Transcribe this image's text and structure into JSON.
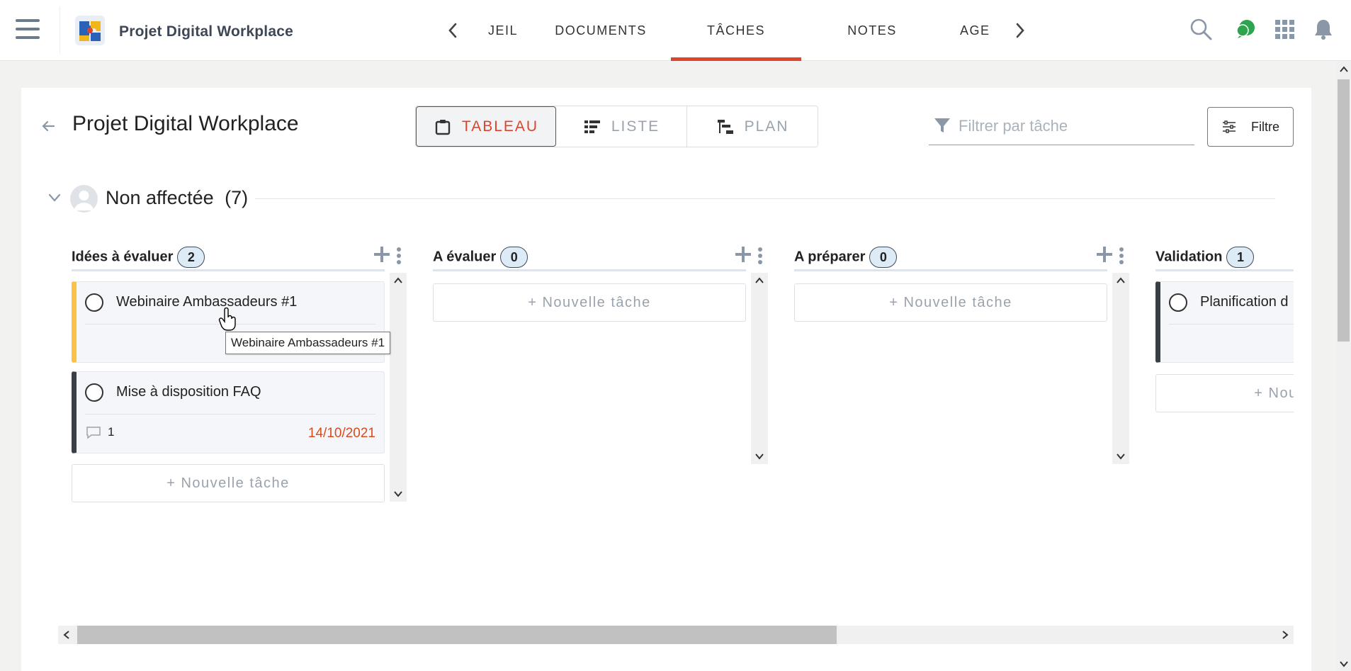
{
  "header": {
    "app_title": "Projet Digital Workplace",
    "tabs": [
      {
        "label": "JEIL"
      },
      {
        "label": "DOCUMENTS"
      },
      {
        "label": "TÂCHES",
        "active": true
      },
      {
        "label": "NOTES"
      },
      {
        "label": "AGE"
      }
    ],
    "icons": [
      "menu-icon",
      "search-icon",
      "chat-icon",
      "apps-grid-icon",
      "bell-icon"
    ]
  },
  "page": {
    "title": "Projet Digital Workplace",
    "views": [
      {
        "label": "TABLEAU",
        "icon": "board-icon",
        "active": true
      },
      {
        "label": "LISTE",
        "icon": "list-icon"
      },
      {
        "label": "PLAN",
        "icon": "gantt-icon"
      }
    ],
    "filter_placeholder": "Filtrer par tâche",
    "filter_button": "Filtre"
  },
  "group": {
    "title": "Non affectée",
    "count": "(7)"
  },
  "columns": [
    {
      "title": "Idées à évaluer",
      "count": "2",
      "tasks": [
        {
          "title": "Webinaire Ambassadeurs #1",
          "accent": "#ffc145"
        },
        {
          "title": "Mise à disposition FAQ",
          "comments": "1",
          "due": "14/10/2021",
          "accent": "#3a3f46"
        }
      ],
      "new_task": "+ Nouvelle tâche"
    },
    {
      "title": "A évaluer",
      "count": "0",
      "tasks": [],
      "new_task": "+ Nouvelle tâche"
    },
    {
      "title": "A préparer",
      "count": "0",
      "tasks": [],
      "new_task": "+ Nouvelle tâche"
    },
    {
      "title": "Validation",
      "count": "1",
      "tasks": [
        {
          "title": "Planification d",
          "accent": "#3a3f46"
        }
      ],
      "new_task": "+ Nou"
    }
  ],
  "tooltip": "Webinaire Ambassadeurs #1",
  "colors": {
    "accent": "#e0432b",
    "due_date": "#d94a1e",
    "badge_bg": "#dcebf6",
    "chat_green": "#2ea44f"
  }
}
